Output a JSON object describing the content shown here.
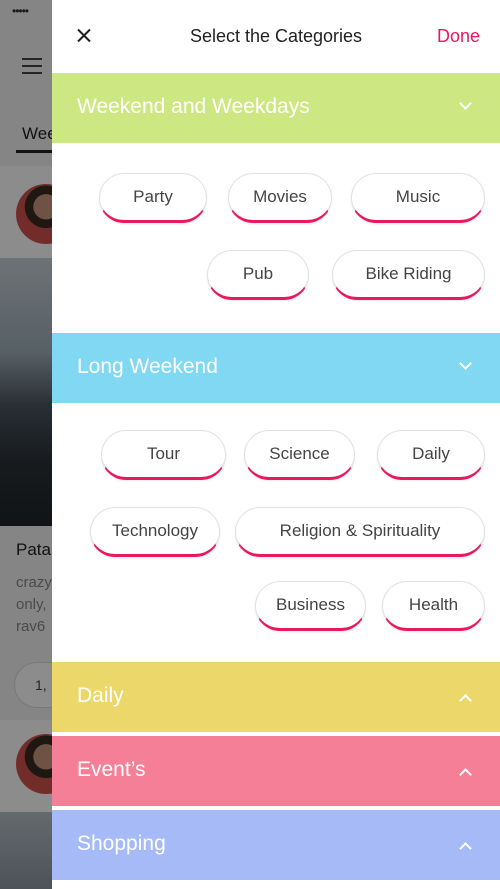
{
  "background": {
    "status_dots": "•••••",
    "tab_label": "Wee",
    "post_title": "Pata",
    "post_lines": [
      "crazy",
      "only,",
      "rav6"
    ],
    "pill_text": "1,"
  },
  "header": {
    "title": "Select the Categories",
    "done_label": "Done"
  },
  "sections": [
    {
      "label": "Weekend and Weekdays",
      "color": "#cde882",
      "expanded": true,
      "chips": [
        "Party",
        "Movies",
        "Music",
        "Pub",
        "Bike Riding"
      ]
    },
    {
      "label": "Long Weekend",
      "color": "#80d8f2",
      "expanded": true,
      "chips": [
        "Tour",
        "Science",
        "Daily",
        "Technology",
        "Religion & Spirituality",
        "Business",
        "Health"
      ]
    },
    {
      "label": "Daily",
      "color": "#ecd76a",
      "expanded": false
    },
    {
      "label": "Event’s",
      "color": "#f57f97",
      "expanded": false
    },
    {
      "label": "Shopping",
      "color": "#a7baf8",
      "expanded": false
    }
  ],
  "colors": {
    "accent": "#e8195f"
  },
  "icons": {
    "close": "close-icon",
    "expand": "chevron-down-icon",
    "collapse": "chevron-up-icon"
  }
}
